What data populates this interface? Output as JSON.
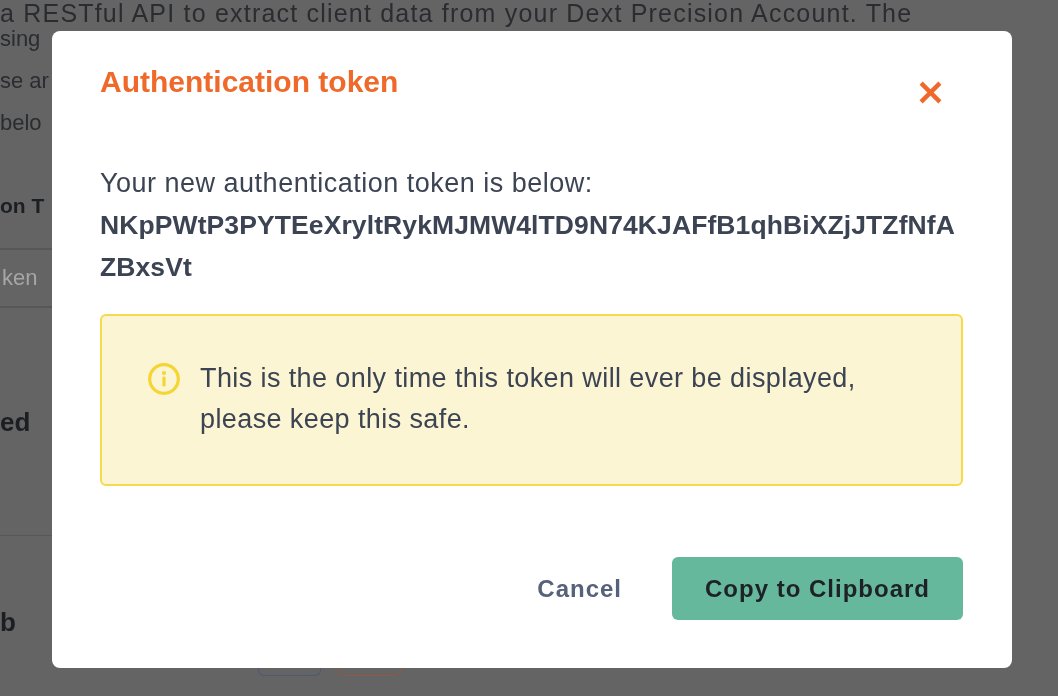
{
  "background_page": {
    "paragraph_lines": [
      "a RESTful API to extract client data from your Dext Precision Account. The",
      "sing",
      "se ar",
      "belo"
    ],
    "section_heading": "on T",
    "token_name_field": {
      "placeholder": "ken"
    },
    "rows": [
      {
        "label": "ed"
      },
      {
        "label": "b"
      }
    ],
    "buttons": [
      {
        "kind": "primary"
      },
      {
        "kind": "danger"
      }
    ]
  },
  "dialog": {
    "title": "Authentication token",
    "intro": "Your new authentication token is below:",
    "token": "NKpPWtP3PYTEeXryltRykMJMW4lTD9N74KJAFfB1qhBiXZjJTZfNfAZBxsVt",
    "notice": "This is the only time this token will ever be displayed, please keep this safe.",
    "buttons": [
      {
        "label": "Cancel",
        "kind": "secondary"
      },
      {
        "label": "Copy to Clipboard",
        "kind": "primary"
      }
    ]
  }
}
